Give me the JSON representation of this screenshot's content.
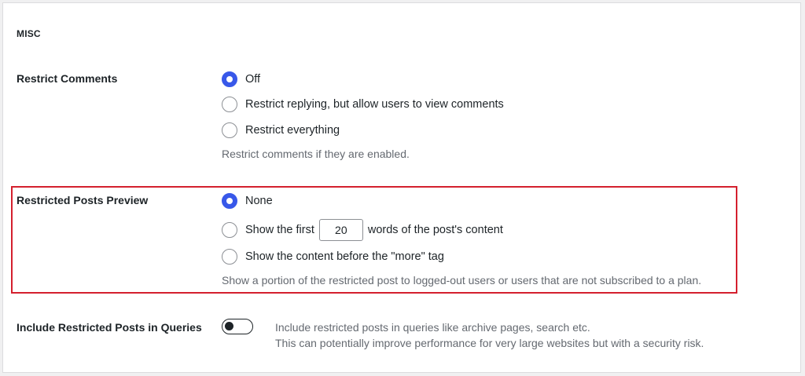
{
  "section": {
    "title": "MISC"
  },
  "restrict_comments": {
    "label": "Restrict Comments",
    "options": [
      {
        "label": "Off",
        "checked": true
      },
      {
        "label": "Restrict replying, but allow users to view comments",
        "checked": false
      },
      {
        "label": "Restrict everything",
        "checked": false
      }
    ],
    "description": "Restrict comments if they are enabled."
  },
  "restricted_posts_preview": {
    "label": "Restricted Posts Preview",
    "options": [
      {
        "label": "None",
        "checked": true
      },
      {
        "label_before": "Show the first",
        "word_count": "20",
        "label_after": "words of the post's content",
        "checked": false
      },
      {
        "label": "Show the content before the \"more\" tag",
        "checked": false
      }
    ],
    "description": "Show a portion of the restricted post to logged-out users or users that are not subscribed to a plan.",
    "highlight_color": "#d4202e"
  },
  "include_in_queries": {
    "label": "Include Restricted Posts in Queries",
    "enabled": false,
    "description_line1": "Include restricted posts in queries like archive pages, search etc.",
    "description_line2": "This can potentially improve performance for very large websites but with a security risk."
  },
  "colors": {
    "accent": "#3858e9",
    "text": "#1d2327",
    "muted": "#646970"
  }
}
